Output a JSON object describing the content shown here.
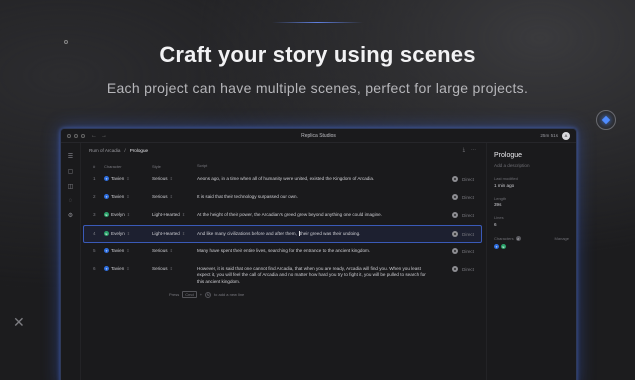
{
  "hero": {
    "headline": "Craft your story using scenes",
    "subline": "Each project can have multiple scenes, perfect for large projects."
  },
  "window": {
    "title": "Replica Studios",
    "usage": "25m 51s",
    "avatar_initial": "A",
    "nav_back": "←",
    "nav_forward": "→"
  },
  "breadcrumb": {
    "project": "Rum of Arcadia",
    "separator": "/",
    "current": "Prologue"
  },
  "table": {
    "headers": {
      "num": "#",
      "character": "Character",
      "style": "Style",
      "script": "Script"
    },
    "rows": [
      {
        "num": "1",
        "avatar": "T",
        "character": "Tavien",
        "style": "Serious",
        "text": "Aeons ago, in a time when all of humanity were united, existed the Kingdom of Arcadia.",
        "action": "Direct"
      },
      {
        "num": "2",
        "avatar": "T",
        "character": "Tavien",
        "style": "Serious",
        "text": "It is said that their technology surpassed our own.",
        "action": "Direct"
      },
      {
        "num": "3",
        "avatar": "E",
        "character": "Evelyn",
        "style": "Light-Hearted",
        "text": "At the height of their power, the Arcadian's greed grew beyond anything one could imagine.",
        "action": "Direct"
      },
      {
        "num": "4",
        "avatar": "E",
        "character": "Evelyn",
        "style": "Light-Hearted",
        "text_before": "And like many civilizations before and after them,",
        "text_after": "their greed was their undoing.",
        "action": "Direct"
      },
      {
        "num": "5",
        "avatar": "T",
        "character": "Tavien",
        "style": "Serious",
        "text": "Many have spent their entire lives, searching for the entrance to the ancient kingdom.",
        "action": "Direct"
      },
      {
        "num": "6",
        "avatar": "T",
        "character": "Tavien",
        "style": "Serious",
        "text": "However, it is said that one cannot find Arcadia, that when you are ready, Arcadia will find you. When you least expect it, you will feel the call of Arcadia and no matter how hard you try to fight it, you will be pulled to search for this ancient kingdom.",
        "action": "Direct"
      }
    ],
    "hint": {
      "press": "Press",
      "key1": "Cmd",
      "plus": "+",
      "key2": "N",
      "rest": "to add a new line"
    }
  },
  "inspector": {
    "title": "Prologue",
    "description_placeholder": "Add a description",
    "last_modified_label": "Last modified",
    "last_modified_value": "1 min ago",
    "length_label": "Length",
    "length_value": "39s",
    "lines_label": "Lines",
    "lines_value": "6",
    "characters_label": "Characters",
    "characters_count": "2",
    "manage_label": "Manage",
    "character_avatars": [
      "T",
      "E"
    ]
  },
  "colors": {
    "accent": "#4f8cff",
    "avatar_t": "#2f6fe0",
    "avatar_e": "#2aa36b",
    "selection_border": "#3a5ab8"
  }
}
